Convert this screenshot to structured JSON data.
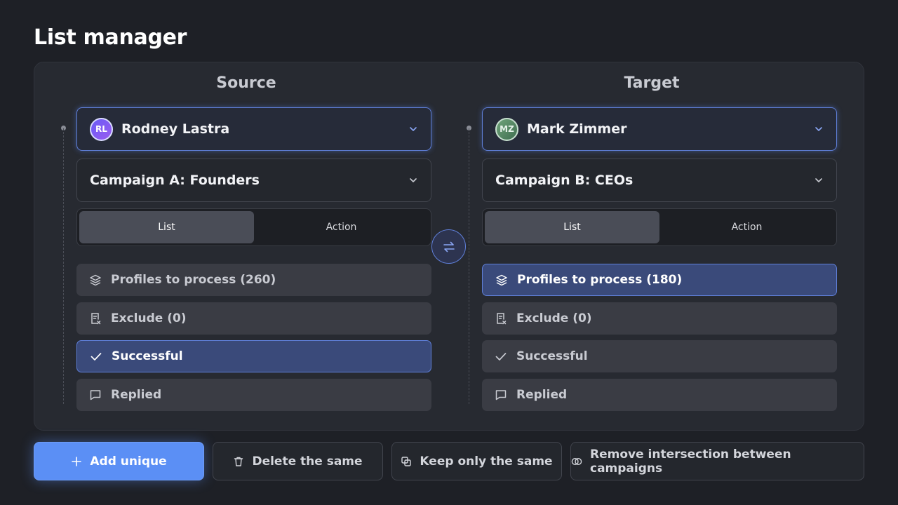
{
  "page": {
    "title": "List manager"
  },
  "source": {
    "title": "Source",
    "account": {
      "initials": "RL",
      "name": "Rodney Lastra"
    },
    "campaign": "Campaign A: Founders",
    "tabs": [
      {
        "label": "List",
        "active": true
      },
      {
        "label": "Action",
        "active": false
      }
    ],
    "items": [
      {
        "icon": "layers-icon",
        "label": "Profiles to process (260)",
        "selected": false
      },
      {
        "icon": "exclude-doc-icon",
        "label": "Exclude (0)",
        "selected": false
      },
      {
        "icon": "check-icon",
        "label": "Successful",
        "selected": true
      },
      {
        "icon": "chat-bubble-icon",
        "label": "Replied",
        "selected": false
      }
    ]
  },
  "target": {
    "title": "Target",
    "account": {
      "initials": "MZ",
      "name": "Mark Zimmer"
    },
    "campaign": "Campaign B: CEOs",
    "tabs": [
      {
        "label": "List",
        "active": true
      },
      {
        "label": "Action",
        "active": false
      }
    ],
    "items": [
      {
        "icon": "layers-icon",
        "label": "Profiles to process (180)",
        "selected": true
      },
      {
        "icon": "exclude-doc-icon",
        "label": "Exclude (0)",
        "selected": false
      },
      {
        "icon": "check-icon",
        "label": "Successful",
        "selected": false
      },
      {
        "icon": "chat-bubble-icon",
        "label": "Replied",
        "selected": false
      }
    ]
  },
  "swap": {
    "icon": "swap-arrows-icon"
  },
  "actions": [
    {
      "icon": "plus-icon",
      "label": "Add unique",
      "primary": true
    },
    {
      "icon": "trash-icon",
      "label": "Delete the same",
      "primary": false
    },
    {
      "icon": "copy-squares-icon",
      "label": "Keep only the same",
      "primary": false
    },
    {
      "icon": "intersection-icon",
      "label": "Remove intersection between campaigns",
      "primary": false
    }
  ],
  "colors": {
    "accent": "#5b8ff5",
    "background": "#1e2026",
    "panel": "#272a31",
    "selected": "#3a4a7a"
  }
}
